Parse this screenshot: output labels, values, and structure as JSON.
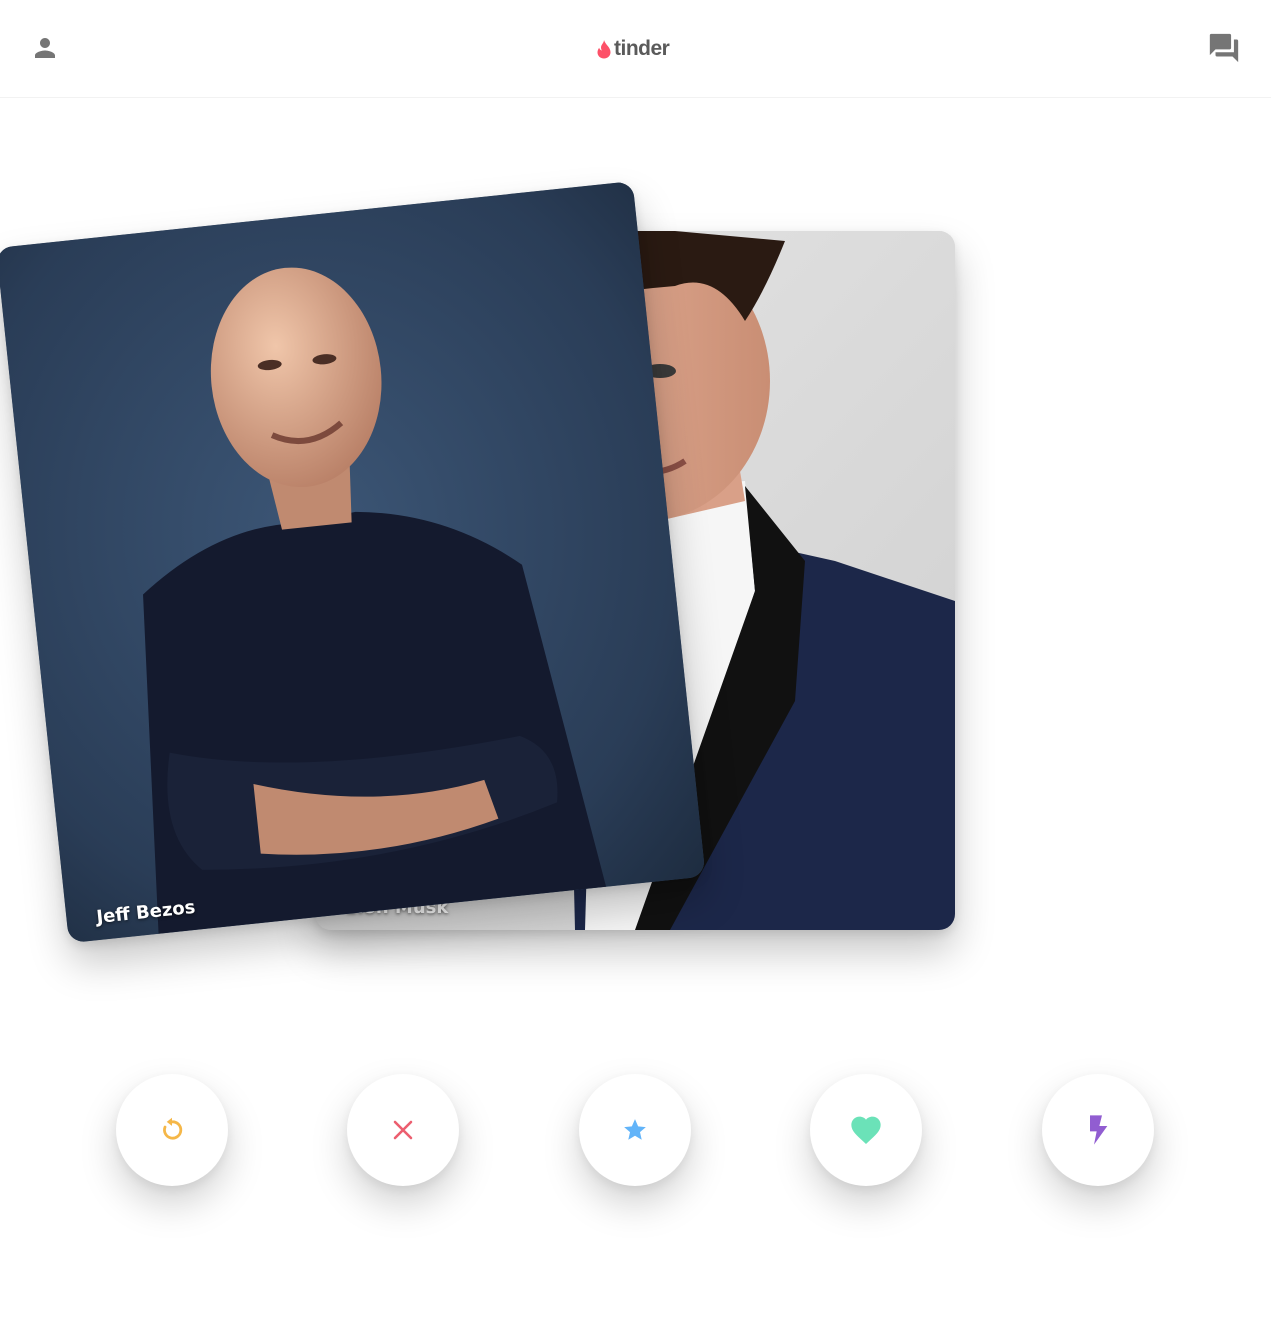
{
  "header": {
    "logo_text": "tinder",
    "icons": {
      "profile": "person-icon",
      "messages": "chat-icon",
      "logo": "flame-icon"
    }
  },
  "cards": [
    {
      "name": "Elon Musk",
      "position": "back"
    },
    {
      "name": "Jeff Bezos",
      "position": "front"
    }
  ],
  "actions": [
    {
      "id": "rewind",
      "icon": "rewind-icon",
      "color": "#f5b748"
    },
    {
      "id": "nope",
      "icon": "close-icon",
      "color": "#ec5e6f"
    },
    {
      "id": "super_like",
      "icon": "star-icon",
      "color": "#62b4f9"
    },
    {
      "id": "like",
      "icon": "heart-icon",
      "color": "#6be2b8"
    },
    {
      "id": "boost",
      "icon": "lightning-icon",
      "color": "#915dd1"
    }
  ],
  "colors": {
    "brand": "#fd5068",
    "icon_gray": "#757575"
  }
}
